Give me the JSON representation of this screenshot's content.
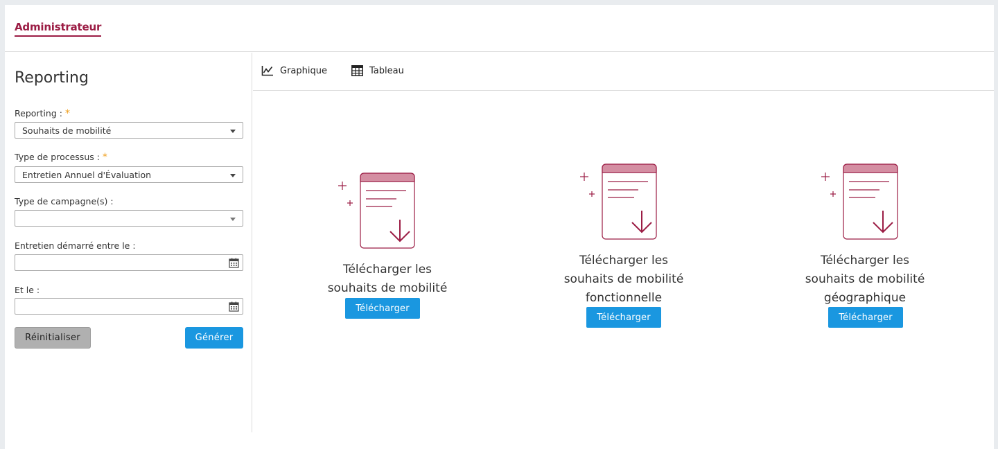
{
  "header": {
    "active_tab": "Administrateur"
  },
  "sidebar": {
    "title": "Reporting",
    "fields": [
      {
        "label": "Reporting :",
        "required": true,
        "value": "Souhaits de mobilité"
      },
      {
        "label": "Type de processus :",
        "required": true,
        "value": "Entretien Annuel d'Évaluation"
      },
      {
        "label": "Type de campagne(s) :",
        "required": false,
        "value": ""
      },
      {
        "label": "Entretien démarré entre le :",
        "value": ""
      },
      {
        "label": "Et le :",
        "value": ""
      }
    ],
    "required_mark": "*",
    "reset_label": "Réinitialiser",
    "generate_label": "Générer"
  },
  "view_tabs": [
    {
      "label": "Graphique",
      "icon": "line-chart-icon"
    },
    {
      "label": "Tableau",
      "icon": "table-icon"
    }
  ],
  "cards": [
    {
      "title_line1": "Télécharger les",
      "title_line2": "souhaits de mobilité",
      "title_line3": "",
      "button_label": "Télécharger"
    },
    {
      "title_line1": "Télécharger les",
      "title_line2": "souhaits de mobilité",
      "title_line3": "fonctionnelle",
      "button_label": "Télécharger"
    },
    {
      "title_line1": "Télécharger les",
      "title_line2": "souhaits de mobilité",
      "title_line3": "géographique",
      "button_label": "Télécharger"
    }
  ],
  "colors": {
    "accent": "#9b1c44",
    "primary_button": "#1a97e0",
    "reset_button": "#b0b0b0",
    "required": "#f0a020",
    "illustration_header": "#d48ea2"
  }
}
